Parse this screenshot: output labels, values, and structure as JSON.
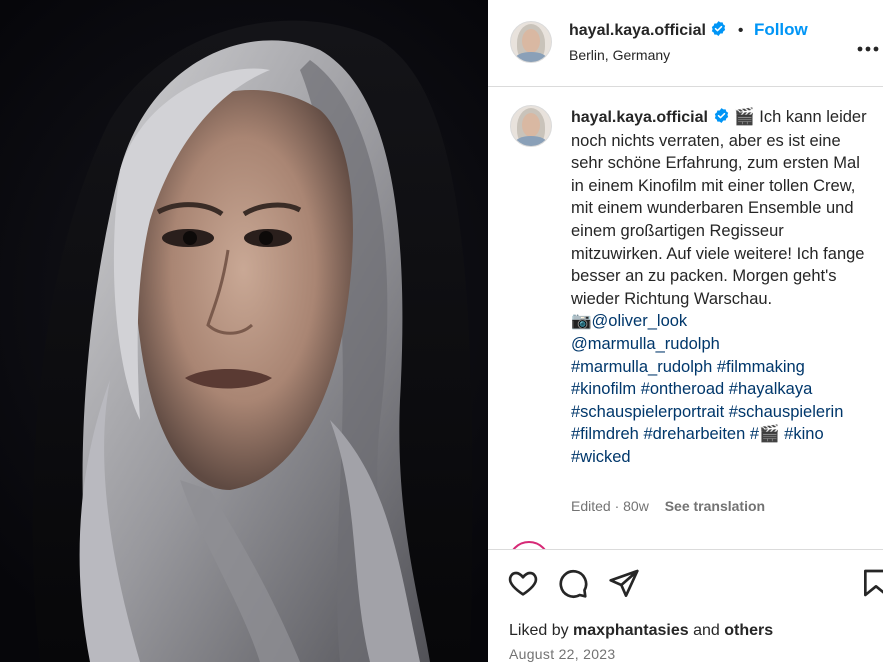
{
  "post": {
    "username": "hayal.kaya.official",
    "location": "Berlin, Germany",
    "follow_label": "Follow",
    "separator": "•",
    "more_label": "•••"
  },
  "caption": {
    "username": "hayal.kaya.official",
    "emoji_clapper": "🎬",
    "text": " Ich kann leider noch nichts verraten, aber es ist eine sehr schöne Erfahrung, zum ersten Mal in einem Kinofilm mit einer tollen Crew, mit einem wunderbaren Ensemble und einem großartigen Regisseur mitzuwirken. Auf viele weitere! Ich fange besser an zu packen. Morgen geht's wieder Richtung Warschau.",
    "emoji_camera": "📷",
    "mention_1": "@oliver_look",
    "mention_2": "@marmulla_rudolph",
    "tags_1": "#marmulla_rudolph #filmmaking #kinofilm #ontheroad #hayalkaya #schauspielerportrait #schauspielerin #filmdreh #dreharbeiten #",
    "tags_emoji": "🎬",
    "tags_2": " #kino #wicked"
  },
  "meta": {
    "edited": "Edited · 80w",
    "see_translation": "See translation"
  },
  "footer": {
    "liked_by_prefix": "Liked by ",
    "liked_by_user": "maxphantasies",
    "liked_by_and": " and ",
    "liked_by_others": "others",
    "date": "August 22, 2023"
  },
  "colors": {
    "accent": "#0095f6",
    "hashtag": "#00376b",
    "muted": "#737373",
    "border": "#dbdbdb"
  },
  "icons": [
    "verified-badge-icon",
    "more-options-icon",
    "heart-icon",
    "comment-icon",
    "share-icon",
    "bookmark-icon"
  ]
}
